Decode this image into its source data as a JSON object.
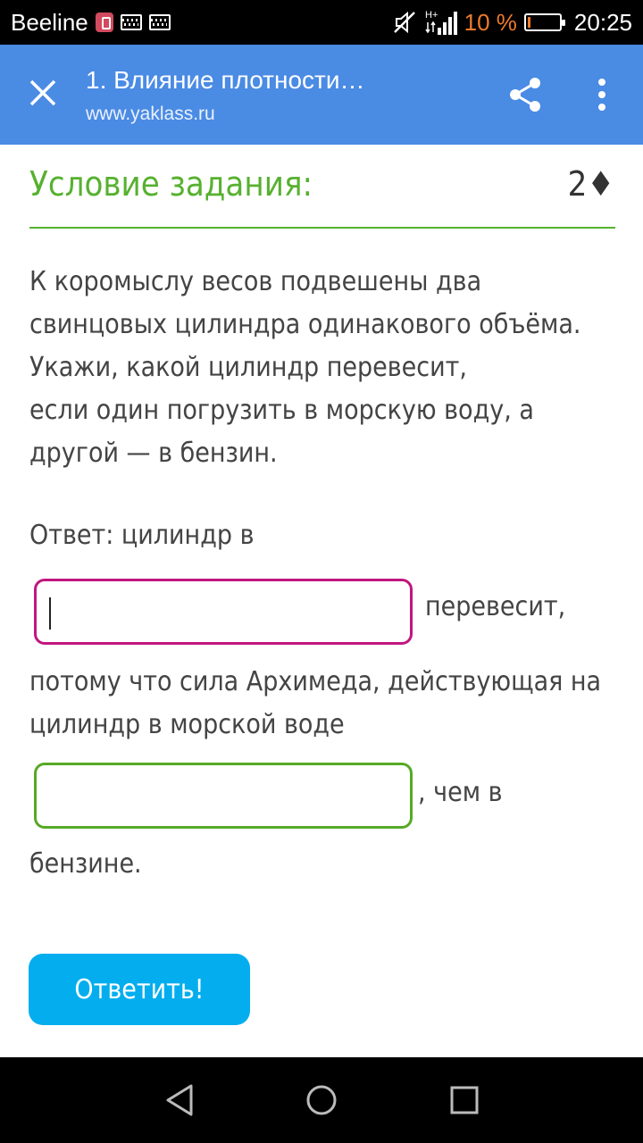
{
  "status_bar": {
    "carrier": "Beeline",
    "network": "H+",
    "battery_percent": "10 %",
    "battery_level": 0.1,
    "time": "20:25",
    "colors": {
      "battery": "#f07a2b"
    }
  },
  "app_bar": {
    "title": "1. Влияние плотности…",
    "url": "www.yaklass.ru",
    "close_icon": "close-icon",
    "share_icon": "share-icon",
    "more_icon": "more-vert-icon",
    "color": "#4a8be4"
  },
  "task": {
    "heading": "Условие задания:",
    "points": "2♦",
    "text_lines": [
      "К коромыслу весов подвешены два",
      "свинцовых цилиндра одинакового объёма.",
      "Укажи, какой цилиндр перевесит,",
      "если один погрузить в морскую воду, а",
      "другой — в бензин."
    ],
    "answer_prefix": "Ответ: цилиндр в",
    "input1_value": "",
    "after_input1": "перевесит,",
    "middle_lines": [
      "потому что сила Архимеда, действующая на",
      "цилиндр в морской воде"
    ],
    "input2_value": "",
    "after_input2": ", чем в",
    "ending": "бензине.",
    "colors": {
      "heading": "#57b130",
      "input1_border": "#c1167f",
      "input2_border": "#56a926"
    }
  },
  "submit_button": {
    "label": "Ответить!",
    "color": "#04aeee"
  },
  "nav_bar": {
    "back_icon": "back-icon",
    "home_icon": "home-icon",
    "recent_icon": "recent-apps-icon"
  }
}
